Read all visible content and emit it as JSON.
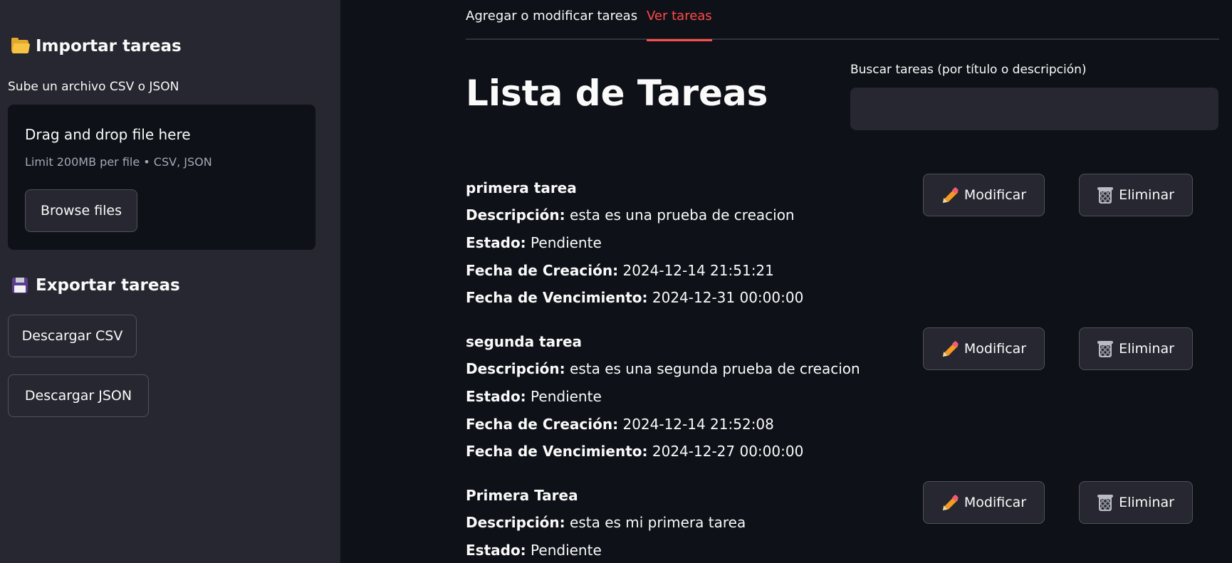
{
  "sidebar": {
    "import_heading": "Importar tareas",
    "import_icon": "folder-icon",
    "upload_caption": "Sube un archivo CSV o JSON",
    "uploader": {
      "title": "Drag and drop file here",
      "limit": "Limit 200MB per file • CSV, JSON",
      "browse_label": "Browse files"
    },
    "export_heading": "Exportar tareas",
    "export_icon": "floppy-disk-icon",
    "download_csv": "Descargar CSV",
    "download_json": "Descargar JSON"
  },
  "tabs": [
    {
      "label": "Agregar o modificar tareas",
      "active": false
    },
    {
      "label": "Ver tareas",
      "active": true
    }
  ],
  "main": {
    "title": "Lista de Tareas",
    "search": {
      "label": "Buscar tareas (por título o descripción)",
      "value": "",
      "placeholder": ""
    },
    "field_labels": {
      "description": "Descripción:",
      "status": "Estado:",
      "created": "Fecha de Creación:",
      "due": "Fecha de Vencimiento:"
    },
    "modify_label": "Modificar",
    "delete_label": "Eliminar",
    "tasks": [
      {
        "title": "primera tarea",
        "description": "esta es una prueba de creacion",
        "status": "Pendiente",
        "created": "2024-12-14 21:51:21",
        "due": "2024-12-31 00:00:00"
      },
      {
        "title": "segunda tarea",
        "description": "esta es una segunda prueba de creacion",
        "status": "Pendiente",
        "created": "2024-12-14 21:52:08",
        "due": "2024-12-27 00:00:00"
      },
      {
        "title": "Primera Tarea",
        "description": "esta es mi primera tarea",
        "status": "Pendiente"
      }
    ]
  },
  "colors": {
    "background": "#0e1117",
    "sidebar": "#262730",
    "accent": "#ff4b4b",
    "text": "#fafafa"
  }
}
